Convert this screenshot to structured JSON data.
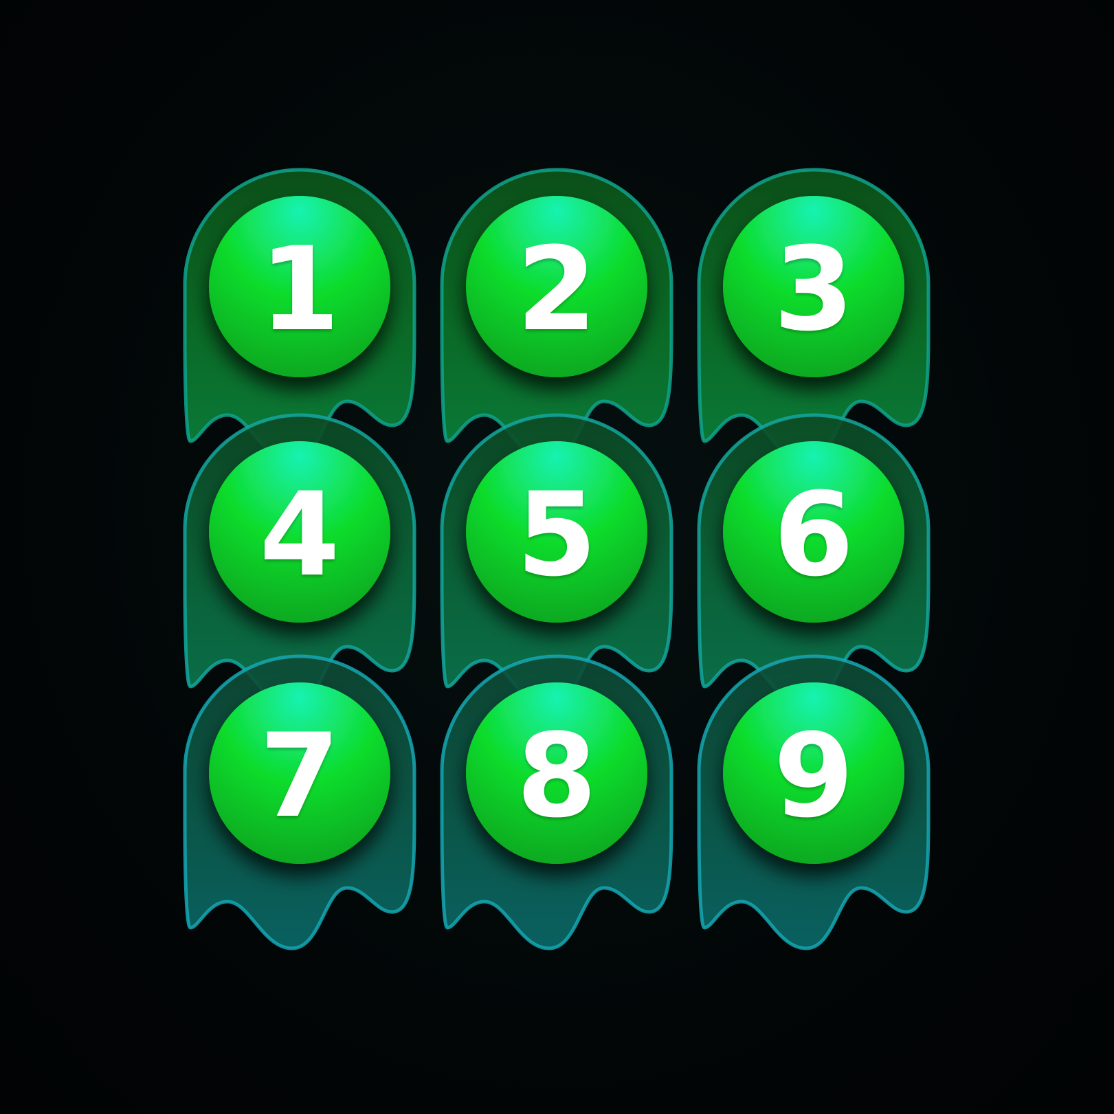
{
  "keypad": {
    "keys": [
      {
        "label": "1"
      },
      {
        "label": "2"
      },
      {
        "label": "3"
      },
      {
        "label": "4"
      },
      {
        "label": "5"
      },
      {
        "label": "6"
      },
      {
        "label": "7"
      },
      {
        "label": "8"
      },
      {
        "label": "9"
      }
    ]
  },
  "colors": {
    "background": "#020607",
    "ball_top": "#18f2b2",
    "ball_mid": "#0fdc2c",
    "ball_bottom": "#0a9a1e",
    "jelly_row_1_top": "#0b4f18",
    "jelly_row_1_bottom": "#0a7a3a",
    "jelly_row_2_top": "#0c4a24",
    "jelly_row_2_bottom": "#0a7a52",
    "jelly_row_3_top": "#0d4a34",
    "jelly_row_3_bottom": "#0a6a6a",
    "rim_row_1": "#11a58e",
    "rim_row_2": "#13a8a0",
    "rim_row_3": "#15a8b4",
    "digit": "#ffffff"
  }
}
